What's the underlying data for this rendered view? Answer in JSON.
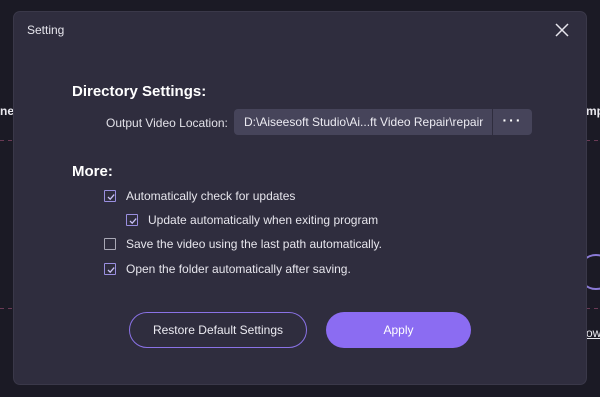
{
  "background": {
    "left_fragment": "ne",
    "right_fragment": "mp",
    "right_link_fragment": "ow"
  },
  "dialog": {
    "title": "Setting",
    "close_icon": "close-icon"
  },
  "directory": {
    "heading": "Directory Settings:",
    "output_label": "Output Video Location:",
    "output_path": "D:\\Aiseesoft Studio\\Ai...ft Video Repair\\repair",
    "browse_label": "···"
  },
  "more": {
    "heading": "More:",
    "options": [
      {
        "label": "Automatically check for updates",
        "checked": true
      },
      {
        "label": "Update automatically when exiting program",
        "checked": true
      },
      {
        "label": "Save the video using the last path automatically.",
        "checked": false
      },
      {
        "label": "Open the folder automatically after saving.",
        "checked": true
      }
    ]
  },
  "buttons": {
    "restore": "Restore Default Settings",
    "apply": "Apply"
  },
  "colors": {
    "accent": "#8b6cf2",
    "dialog_bg": "#2f2d3e",
    "field_bg": "#46445a"
  }
}
